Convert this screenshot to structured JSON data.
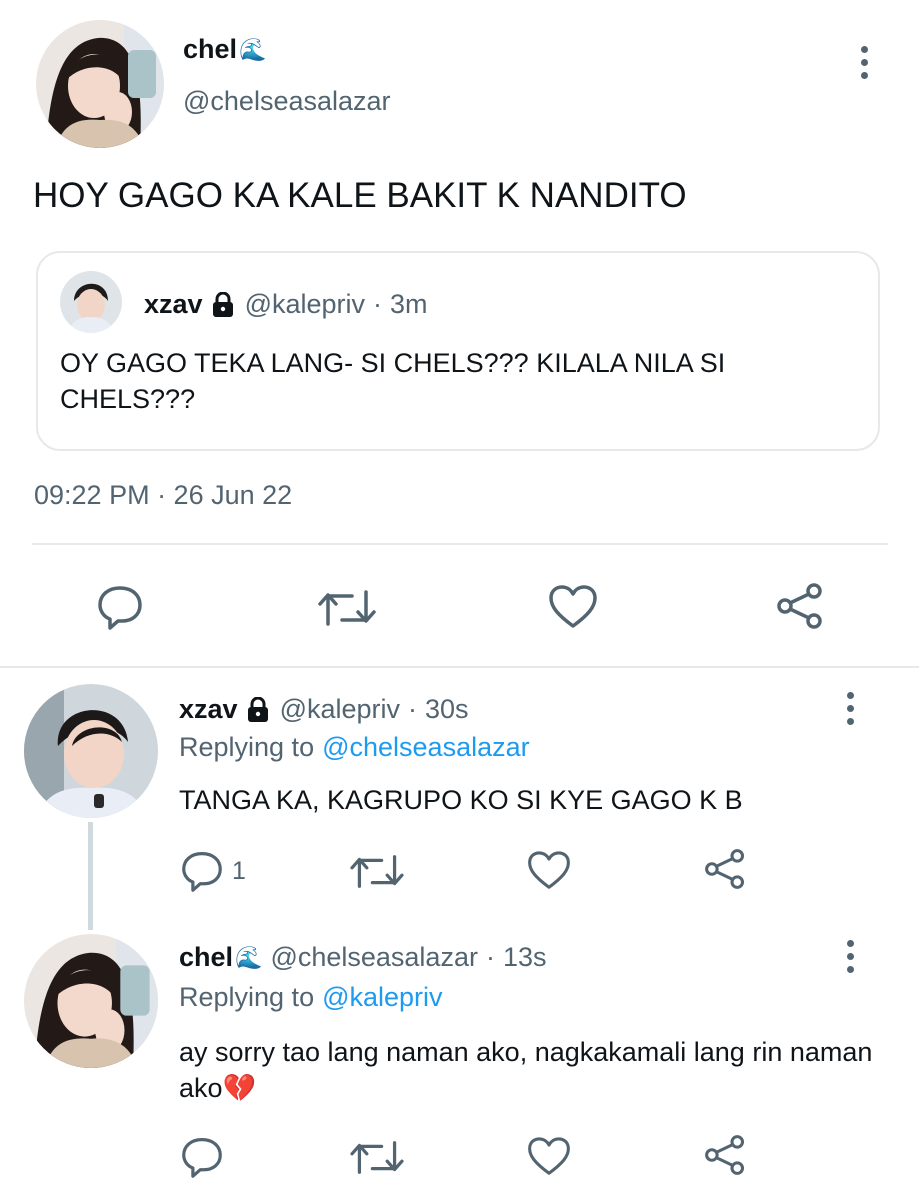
{
  "main_tweet": {
    "display_name": "chel",
    "name_emoji": "🌊",
    "handle": "@chelseasalazar",
    "text": "HOY GAGO KA KALE BAKIT K NANDITO",
    "timestamp": "09:22 PM · 26 Jun 22",
    "quoted": {
      "display_name": "xzav",
      "handle": "@kalepriv",
      "separator": "·",
      "time": "3m",
      "text": "OY GAGO TEKA LANG- SI CHELS??? KILALA NILA SI CHELS???"
    },
    "actions": [
      "reply-icon",
      "retweet-icon",
      "like-icon",
      "share-icon"
    ]
  },
  "replies": [
    {
      "display_name": "xzav",
      "handle": "@kalepriv",
      "separator": "·",
      "time": "30s",
      "replying_prefix": "Replying to",
      "replying_to": "@chelseasalazar",
      "text": "TANGA KA, KAGRUPO KO SI KYE GAGO K B",
      "reply_count": "1"
    },
    {
      "display_name": "chel",
      "name_emoji": "🌊",
      "handle": "@chelseasalazar",
      "separator": "·",
      "time": "13s",
      "replying_prefix": "Replying to",
      "replying_to": "@kalepriv",
      "text": "ay sorry tao lang naman ako, nagkakamali lang rin naman ako",
      "text_emoji": "💔",
      "reply_count": ""
    }
  ],
  "colors": {
    "text": "#0f1419",
    "secondary": "#536471",
    "link": "#1d9bf0",
    "divider": "#e6e9eb",
    "thread_line": "#cfd9de"
  }
}
